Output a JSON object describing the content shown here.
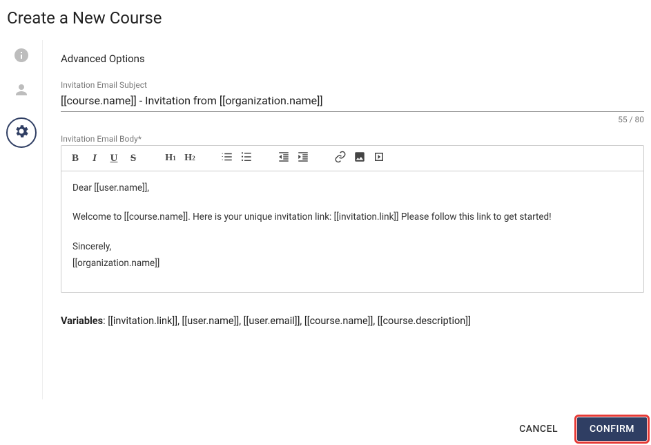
{
  "page": {
    "title": "Create a New Course"
  },
  "stepper": {
    "steps": [
      {
        "name": "info",
        "icon": "info-icon",
        "active": false
      },
      {
        "name": "user",
        "icon": "person-icon",
        "active": false
      },
      {
        "name": "settings",
        "icon": "gear-icon",
        "active": true
      }
    ]
  },
  "section": {
    "heading": "Advanced Options"
  },
  "subject": {
    "label": "Invitation Email Subject",
    "value": "[[course.name]] - Invitation from [[organization.name]]",
    "counter": "55 / 80"
  },
  "body": {
    "label": "Invitation Email Body*",
    "lines": {
      "l1": "Dear [[user.name]],",
      "l2": "Welcome to [[course.name]]. Here is your unique invitation link: [[invitation.link]] Please follow this link to get started!",
      "l3": "Sincerely,",
      "l4": "[[organization.name]]"
    }
  },
  "variables": {
    "label": "Variables",
    "list": ": [[invitation.link]], [[user.name]], [[user.email]], [[course.name]], [[course.description]]"
  },
  "footer": {
    "cancel": "CANCEL",
    "confirm": "CONFIRM"
  },
  "toolbar": {
    "bold": "B",
    "italic": "I",
    "underline": "U",
    "strike": "S",
    "h1a": "H",
    "h1b": "1",
    "h2a": "H",
    "h2b": "2"
  }
}
